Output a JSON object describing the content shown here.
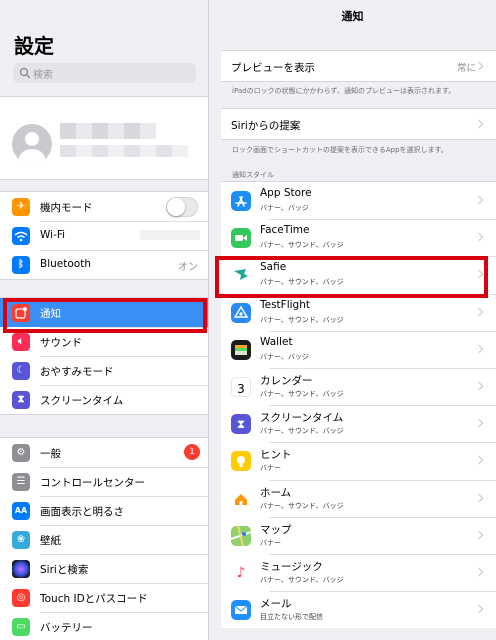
{
  "sidebar": {
    "title": "設定",
    "search_placeholder": "検索",
    "group1": [
      {
        "label": "機内モード",
        "icon": "airplane-icon",
        "color": "#ff9500"
      },
      {
        "label": "Wi-Fi",
        "icon": "wifi-icon",
        "color": "#007aff"
      },
      {
        "label": "Bluetooth",
        "icon": "bluetooth-icon",
        "color": "#007aff",
        "value": "オン"
      }
    ],
    "group2": [
      {
        "label": "通知",
        "icon": "notifications-icon",
        "color": "#ff3b30",
        "active": true
      },
      {
        "label": "サウンド",
        "icon": "sound-icon",
        "color": "#ff2d55"
      },
      {
        "label": "おやすみモード",
        "icon": "moon-icon",
        "color": "#5856d6"
      },
      {
        "label": "スクリーンタイム",
        "icon": "hourglass-icon",
        "color": "#5856d6"
      }
    ],
    "group3": [
      {
        "label": "一般",
        "icon": "gear-icon",
        "color": "#8e8e93",
        "badge": "1"
      },
      {
        "label": "コントロールセンター",
        "icon": "switches-icon",
        "color": "#8e8e93"
      },
      {
        "label": "画面表示と明るさ",
        "icon": "display-icon",
        "color": "#007aff"
      },
      {
        "label": "壁紙",
        "icon": "wallpaper-icon",
        "color": "#34aadc"
      },
      {
        "label": "Siriと検索",
        "icon": "siri-icon",
        "color": "#222233"
      },
      {
        "label": "Touch IDとパスコード",
        "icon": "fingerprint-icon",
        "color": "#ff3b30"
      },
      {
        "label": "バッテリー",
        "icon": "battery-icon",
        "color": "#4cd964"
      }
    ]
  },
  "main": {
    "title": "通知",
    "preview": {
      "label": "プレビューを表示",
      "value": "常に"
    },
    "preview_note": "iPadのロックの状態にかかわらず、通知のプレビューは表示されます。",
    "siri": {
      "label": "Siriからの提案"
    },
    "siri_note": "ロック画面でショートカットの提案を表示できるAppを選択します。",
    "section_header": "通知スタイル",
    "apps": [
      {
        "name": "App Store",
        "sub": "バナー、バッジ",
        "icon": "app-store-icon",
        "color": "#1d8ef5"
      },
      {
        "name": "FaceTime",
        "sub": "バナー、サウンド、バッジ",
        "icon": "facetime-icon",
        "color": "#34c759"
      },
      {
        "name": "Safie",
        "sub": "バナー、サウンド、バッジ",
        "icon": "safie-icon",
        "color": "#1fa8a0"
      },
      {
        "name": "TestFlight",
        "sub": "バナー、サウンド、バッジ",
        "icon": "testflight-icon",
        "color": "#2a8bf2"
      },
      {
        "name": "Wallet",
        "sub": "バナー、バッジ",
        "icon": "wallet-icon",
        "color": "#1c1c1e"
      },
      {
        "name": "カレンダー",
        "sub": "バナー、サウンド、バッジ",
        "icon": "calendar-icon",
        "color": "#ffffff",
        "icon_text": "3"
      },
      {
        "name": "スクリーンタイム",
        "sub": "バナー、サウンド、バッジ",
        "icon": "hourglass-icon",
        "color": "#5856d6"
      },
      {
        "name": "ヒント",
        "sub": "バナー",
        "icon": "tips-icon",
        "color": "#ffcc00"
      },
      {
        "name": "ホーム",
        "sub": "バナー、サウンド、バッジ",
        "icon": "home-icon",
        "color": "#ffffff"
      },
      {
        "name": "マップ",
        "sub": "バナー",
        "icon": "maps-icon",
        "color": "#8fd16a"
      },
      {
        "name": "ミュージック",
        "sub": "バナー、サウンド、バッジ",
        "icon": "music-icon",
        "color": "#ffffff"
      },
      {
        "name": "メール",
        "sub": "目立たない形で配信",
        "icon": "mail-icon",
        "color": "#1e90ff"
      }
    ]
  },
  "highlight_color": "#d8000e"
}
